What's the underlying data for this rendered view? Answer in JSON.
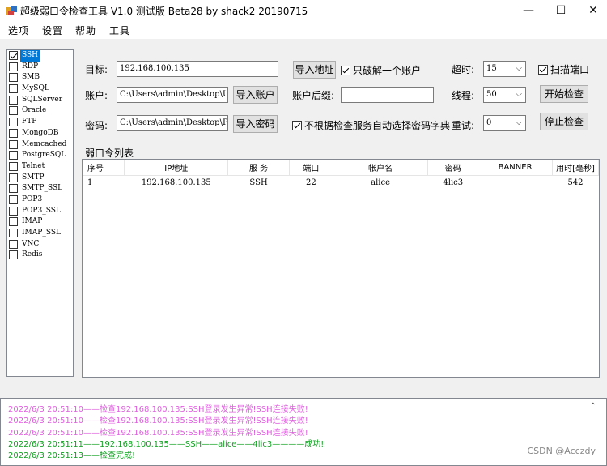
{
  "window": {
    "title": "超级弱口令检查工具 V1.0 测试版 Beta28 by shack2 20190715",
    "minimize": "—",
    "maximize": "☐",
    "close": "✕"
  },
  "menu": [
    "选项",
    "设置",
    "帮助",
    "工具"
  ],
  "protocols": [
    {
      "label": "SSH",
      "checked": true,
      "selected": true
    },
    {
      "label": "RDP",
      "checked": false
    },
    {
      "label": "SMB",
      "checked": false
    },
    {
      "label": "MySQL",
      "checked": false
    },
    {
      "label": "SQLServer",
      "checked": false
    },
    {
      "label": "Oracle",
      "checked": false
    },
    {
      "label": "FTP",
      "checked": false
    },
    {
      "label": "MongoDB",
      "checked": false
    },
    {
      "label": "Memcached",
      "checked": false
    },
    {
      "label": "PostgreSQL",
      "checked": false
    },
    {
      "label": "Telnet",
      "checked": false
    },
    {
      "label": "SMTP",
      "checked": false
    },
    {
      "label": "SMTP_SSL",
      "checked": false
    },
    {
      "label": "POP3",
      "checked": false
    },
    {
      "label": "POP3_SSL",
      "checked": false
    },
    {
      "label": "IMAP",
      "checked": false
    },
    {
      "label": "IMAP_SSL",
      "checked": false
    },
    {
      "label": "VNC",
      "checked": false
    },
    {
      "label": "Redis",
      "checked": false
    }
  ],
  "form": {
    "target_label": "目标:",
    "target_value": "192.168.100.135",
    "import_address": "导入地址",
    "crack_one_label": "只破解一个账户",
    "timeout_label": "超时:",
    "timeout_value": "15",
    "scan_port_label": "扫描端口",
    "account_label": "账户:",
    "account_value": "C:\\Users\\admin\\Desktop\\U.t",
    "import_account": "导入账户",
    "suffix_label": "账户后缀:",
    "suffix_value": "",
    "threads_label": "线程:",
    "threads_value": "50",
    "start_check": "开始检查",
    "password_label": "密码:",
    "password_value": "C:\\Users\\admin\\Desktop\\P.t",
    "import_password": "导入密码",
    "no_auto_dict_label": "不根据检查服务自动选择密码字典",
    "retry_label": "重试:",
    "retry_value": "0",
    "stop_check": "停止检查"
  },
  "results": {
    "group_title": "弱口令列表",
    "columns": [
      "序号",
      "IP地址",
      "服 务",
      "端口",
      "帐户名",
      "密码",
      "BANNER",
      "用时[毫秒]"
    ],
    "rows": [
      [
        "1",
        "192.168.100.135",
        "SSH",
        "22",
        "alice",
        "4lic3",
        "",
        "542"
      ]
    ]
  },
  "log": {
    "lines": [
      {
        "text": "2022/6/3 20:51:10——检查192.168.100.135:SSH登录发生异常!SSH连接失败!",
        "color": "#e060e0"
      },
      {
        "text": "2022/6/3 20:51:10——检查192.168.100.135:SSH登录发生异常!SSH连接失败!",
        "color": "#e060e0"
      },
      {
        "text": "2022/6/3 20:51:10——检查192.168.100.135:SSH登录发生异常!SSH连接失败!",
        "color": "#e060e0"
      },
      {
        "text": "2022/6/3 20:51:11——192.168.100.135——SSH——alice——4lic3————成功!",
        "color": "#10a020"
      },
      {
        "text": "2022/6/3 20:51:13——检查完成!",
        "color": "#10a020"
      }
    ]
  },
  "watermark": "CSDN @Acczdy"
}
